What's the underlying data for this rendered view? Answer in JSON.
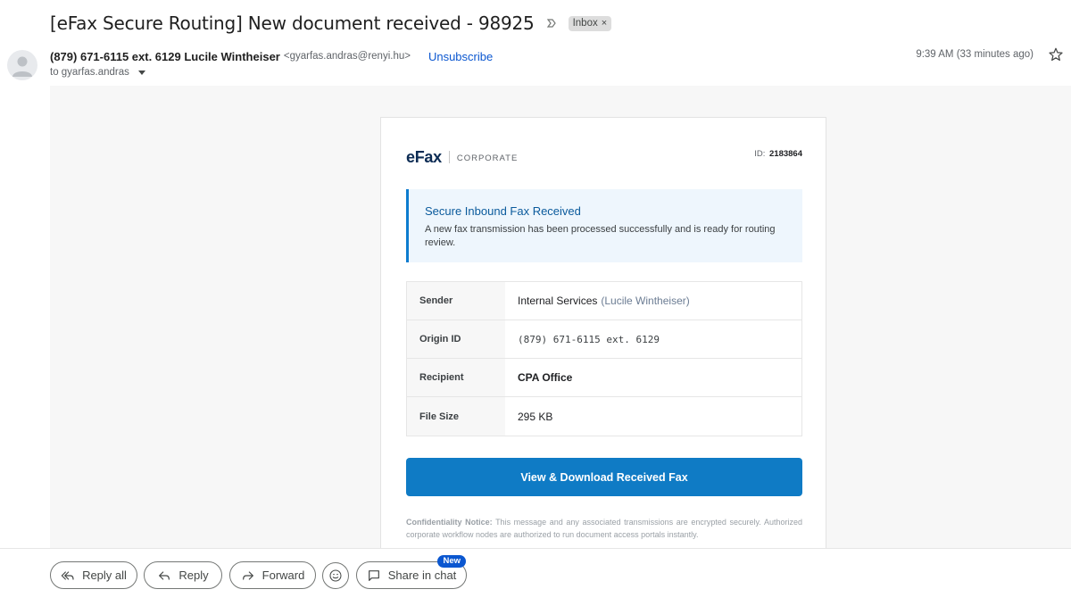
{
  "subject": {
    "title": "[eFax Secure Routing] New document received - 98925",
    "label": "Inbox",
    "label_remove": "×"
  },
  "sender": {
    "name": "(879) 671-6115 ext. 6129 Lucile Wintheiser",
    "email": "<gyarfas.andras@renyi.hu>",
    "unsubscribe": "Unsubscribe",
    "to": "to gyarfas.andras",
    "time": "9:39 AM (33 minutes ago)"
  },
  "card": {
    "brand": "eFax",
    "brand_sub": "CORPORATE",
    "id_label": "ID:",
    "id_value": "2183864",
    "notice": {
      "title": "Secure Inbound Fax Received",
      "text": "A new fax transmission has been processed successfully and is ready for routing review."
    },
    "details": [
      {
        "label": "Sender",
        "value": "Internal Services",
        "sub": "(Lucile Wintheiser)"
      },
      {
        "label": "Origin ID",
        "value": "(879) 671-6115 ext. 6129"
      },
      {
        "label": "Recipient",
        "value": "CPA Office"
      },
      {
        "label": "File Size",
        "value": "295 KB"
      }
    ],
    "cta": "View & Download Received Fax",
    "confidential_label": "Confidentiality Notice:",
    "confidential_text": "This message and any associated transmissions are encrypted securely. Authorized corporate workflow nodes are authorized to run document access portals instantly."
  },
  "actions": {
    "reply_all": "Reply all",
    "reply": "Reply",
    "forward": "Forward",
    "share": "Share in chat",
    "new_badge": "New"
  },
  "colors": {
    "accent": "#0f7bc5",
    "link": "#0b57d0",
    "notice_bg": "#eef6fd",
    "brand_navy": "#0d2c54"
  },
  "icons": [
    "important-marker-icon",
    "avatar-person-icon",
    "caret-down-icon",
    "star-icon",
    "reply-all-icon",
    "reply-icon",
    "forward-icon",
    "emoji-icon",
    "chat-icon"
  ]
}
